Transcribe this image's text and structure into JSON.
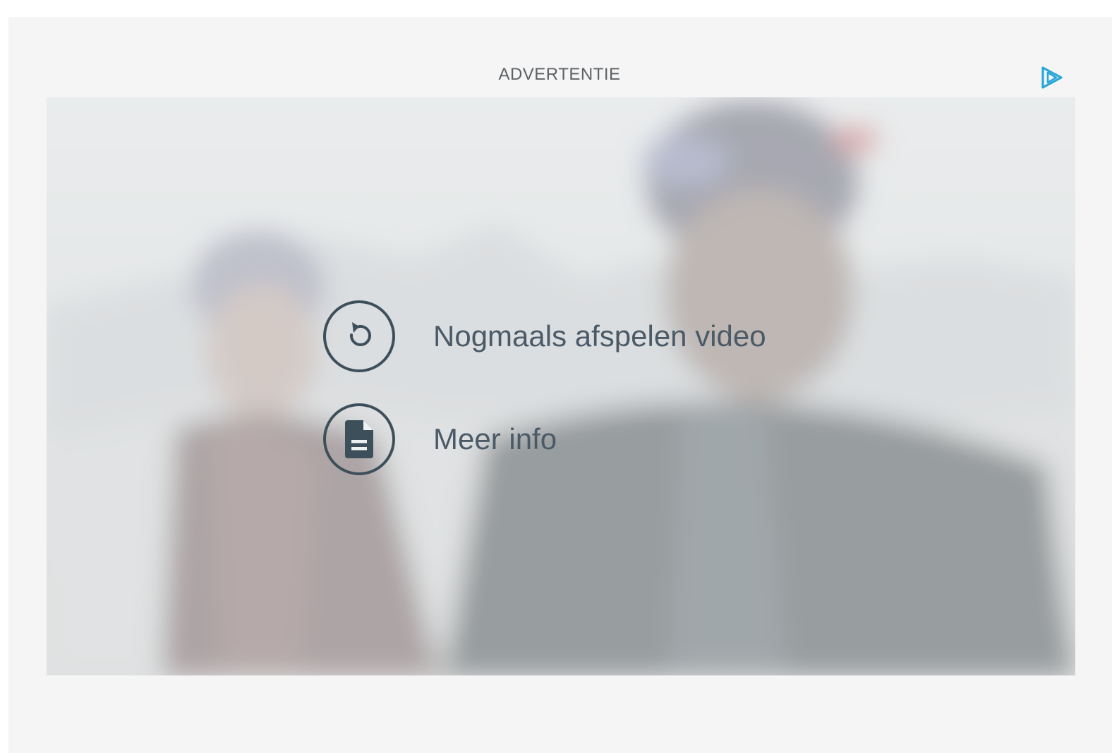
{
  "ad": {
    "label": "ADVERTENTIE",
    "brand_icon": "play-outline-icon",
    "brand_color": "#2aa7d9"
  },
  "video": {
    "state": "ended"
  },
  "end_options": [
    {
      "label": "Nogmaals afspelen video",
      "icon": "replay-icon"
    },
    {
      "label": "Meer info",
      "icon": "document-icon"
    }
  ],
  "colors": {
    "icon_ring": "#3e4f5c",
    "option_text": "#4b5a67",
    "frame_bg": "#f5f5f5"
  }
}
